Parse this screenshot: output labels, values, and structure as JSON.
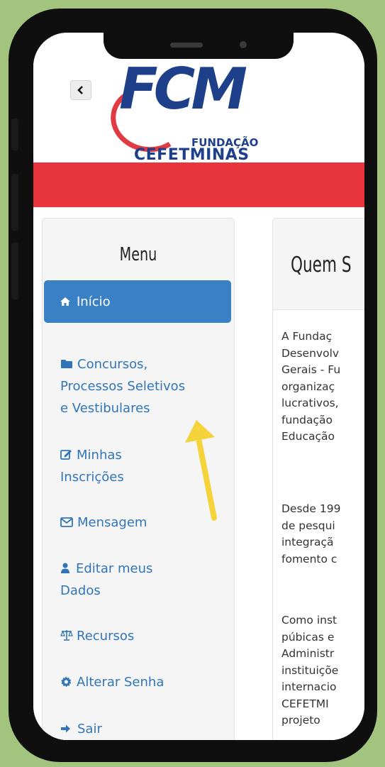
{
  "header": {
    "back_icon": "chevron-left-icon",
    "logo_text": "FCM",
    "logo_line1": "FUNDAÇÃO",
    "logo_line2": "CEFETMINAS"
  },
  "menu": {
    "title": "Menu",
    "items": [
      {
        "icon": "home-icon",
        "label": "Início"
      },
      {
        "icon": "folder-icon",
        "lines": [
          "Concursos,",
          "Processos Seletivos",
          "e Vestibulares"
        ]
      },
      {
        "icon": "edit-icon",
        "lines": [
          "Minhas",
          "Inscrições"
        ]
      },
      {
        "icon": "envelope-icon",
        "label": "Mensagem"
      },
      {
        "icon": "user-icon",
        "lines": [
          "Editar meus",
          "Dados"
        ]
      },
      {
        "icon": "scales-icon",
        "label": "Recursos"
      },
      {
        "icon": "gear-icon",
        "label": "Alterar Senha"
      },
      {
        "icon": "sign-out-icon",
        "label": "Sair"
      }
    ]
  },
  "main": {
    "title": "Quem S",
    "paragraphs": [
      [
        "A Fundaç",
        "Desenvolv",
        "Gerais - Fu",
        "organizaç",
        "lucrativos,",
        "fundação",
        "Educação"
      ],
      [
        "Desde 199",
        "de pesqui",
        "integraçã",
        "fomento c"
      ],
      [
        "Como inst",
        "púbicas e",
        "Administr",
        "instituiçõe",
        "internacio",
        "CEFETMI",
        "projeto"
      ]
    ]
  },
  "colors": {
    "brand_blue": "#1e3f8a",
    "brand_red": "#e8343d",
    "active_menu": "#3a80c5",
    "link": "#3175b8",
    "arrow": "#f5d33a",
    "background": "#a3c47f"
  }
}
